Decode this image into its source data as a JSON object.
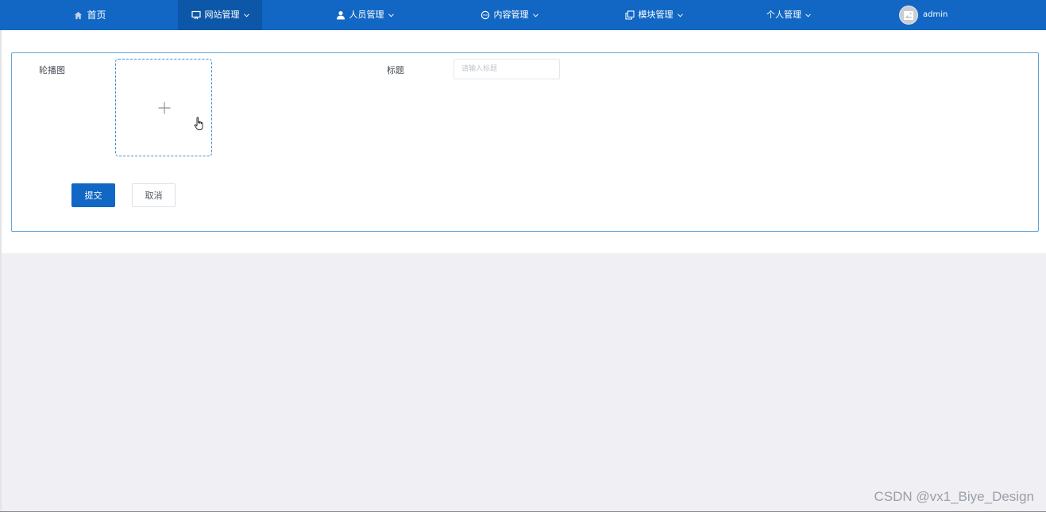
{
  "nav": {
    "home": "首页",
    "website_mgmt": "网站管理",
    "people_mgmt": "人员管理",
    "content_mgmt": "内容管理",
    "module_mgmt": "模块管理",
    "personal_mgmt": "个人管理",
    "user": "admin",
    "accent_color": "#1167c3",
    "active_color": "#0d57a8"
  },
  "icons": {
    "home": "home-icon",
    "website": "monitor-icon",
    "people": "user-icon",
    "content": "chat-icon",
    "module": "copy-icon",
    "dropdown": "chevron-down-icon",
    "upload": "plus-icon"
  },
  "form": {
    "carousel_label": "轮播图",
    "title_label": "标题",
    "title_placeholder": "请输入标题",
    "title_value": "",
    "submit_label": "提交",
    "cancel_label": "取消"
  },
  "watermark": "CSDN @vx1_Biye_Design"
}
